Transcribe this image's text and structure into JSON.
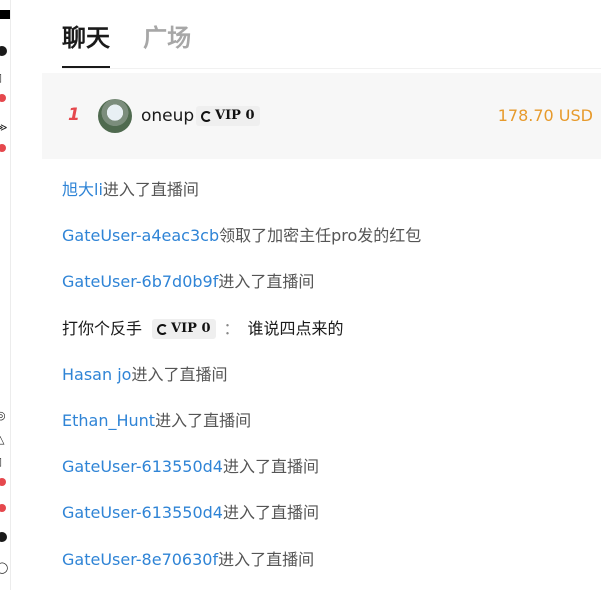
{
  "tabs": [
    {
      "label": "聊天",
      "active": true
    },
    {
      "label": "广场",
      "active": false
    }
  ],
  "top_donor": {
    "rank": "1",
    "username": "oneup",
    "vip_label": "VIP 0",
    "amount": "178.70 USD"
  },
  "messages": [
    {
      "user": "旭大li",
      "text": "进入了直播间"
    },
    {
      "user": "GateUser-a4eac3cb",
      "text": "领取了加密主任pro发的红包"
    },
    {
      "user": "GateUser-6b7d0b9f",
      "text": "进入了直播间"
    },
    {
      "user": "打你个反手",
      "vip_label": "VIP 0",
      "separator": "：",
      "text": "谁说四点来的"
    },
    {
      "user": "Hasan jo",
      "text": "进入了直播间"
    },
    {
      "user": "Ethan_Hunt",
      "text": "进入了直播间"
    },
    {
      "user": "GateUser-613550d4",
      "text": "进入了直播间"
    },
    {
      "user": "GateUser-613550d4",
      "text": "进入了直播间"
    },
    {
      "user": "GateUser-8e70630f",
      "text": "进入了直播间"
    }
  ],
  "colors": {
    "accent_user": "#2f84d6",
    "amount": "#e79a2b",
    "rank": "#e5484d"
  }
}
